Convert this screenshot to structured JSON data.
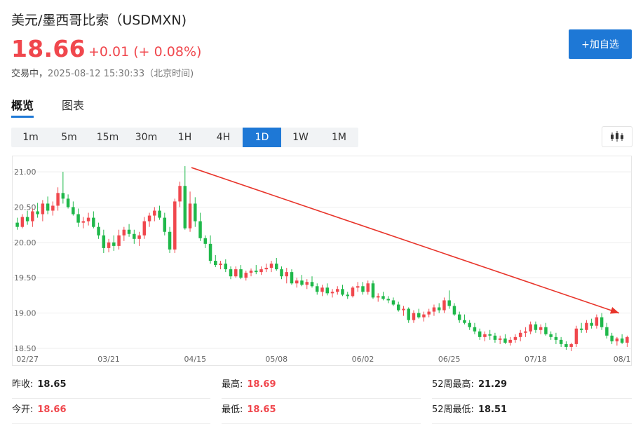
{
  "header": {
    "title": "美元/墨西哥比索（USDMXN)",
    "price": "18.66",
    "change": "+0.01 (+ 0.08%)",
    "status": "交易中，",
    "timestamp": "2025-08-12 15:30:33（北京时间)",
    "add_button": "+加自选"
  },
  "tabs": [
    {
      "label": "概览",
      "active": true
    },
    {
      "label": "图表",
      "active": false
    }
  ],
  "periods": [
    {
      "label": "1m",
      "active": false
    },
    {
      "label": "5m",
      "active": false
    },
    {
      "label": "15m",
      "active": false
    },
    {
      "label": "30m",
      "active": false
    },
    {
      "label": "1H",
      "active": false
    },
    {
      "label": "4H",
      "active": false
    },
    {
      "label": "1D",
      "active": true
    },
    {
      "label": "1W",
      "active": false
    },
    {
      "label": "1M",
      "active": false
    }
  ],
  "chart_type_icon": "candlestick-icon",
  "colors": {
    "up": "#f0474d",
    "down": "#1fb84a",
    "accent": "#1e78d6",
    "annotation_arrow": "#e8352b"
  },
  "chart_data": {
    "type": "candlestick",
    "y_ticks": [
      "21.00",
      "20.50",
      "20.00",
      "19.50",
      "19.00",
      "18.50"
    ],
    "y_tick_values": [
      21.0,
      20.5,
      20.0,
      19.5,
      19.0,
      18.5
    ],
    "ylim": [
      18.42,
      21.14
    ],
    "x_ticks": [
      "02/27",
      "03/21",
      "04/15",
      "05/08",
      "06/02",
      "06/25",
      "07/18",
      "08/1"
    ],
    "x_tick_index": [
      2,
      18,
      35,
      51,
      68,
      85,
      102,
      119
    ],
    "grid": "horizontal",
    "annotation": "downtrend arrow from the April high to the current level",
    "candles": [
      [
        20.28,
        20.35,
        20.18,
        20.22
      ],
      [
        20.22,
        20.4,
        20.2,
        20.36
      ],
      [
        20.36,
        20.45,
        20.25,
        20.3
      ],
      [
        20.3,
        20.48,
        20.22,
        20.44
      ],
      [
        20.44,
        20.56,
        20.35,
        20.4
      ],
      [
        20.4,
        20.6,
        20.3,
        20.55
      ],
      [
        20.55,
        20.65,
        20.4,
        20.45
      ],
      [
        20.45,
        20.58,
        20.38,
        20.52
      ],
      [
        20.52,
        20.78,
        20.45,
        20.7
      ],
      [
        20.7,
        21.0,
        20.55,
        20.62
      ],
      [
        20.62,
        20.68,
        20.48,
        20.5
      ],
      [
        20.5,
        20.58,
        20.38,
        20.4
      ],
      [
        20.4,
        20.48,
        20.22,
        20.28
      ],
      [
        20.28,
        20.36,
        20.2,
        20.3
      ],
      [
        20.3,
        20.42,
        20.24,
        20.35
      ],
      [
        20.35,
        20.44,
        20.2,
        20.22
      ],
      [
        20.22,
        20.28,
        20.05,
        20.1
      ],
      [
        20.1,
        20.18,
        19.85,
        19.92
      ],
      [
        19.92,
        20.05,
        19.86,
        20.0
      ],
      [
        20.0,
        20.1,
        19.88,
        19.95
      ],
      [
        19.95,
        20.18,
        19.9,
        20.1
      ],
      [
        20.1,
        20.22,
        20.02,
        20.18
      ],
      [
        20.18,
        20.26,
        20.08,
        20.12
      ],
      [
        20.12,
        20.18,
        19.98,
        20.05
      ],
      [
        20.05,
        20.15,
        19.95,
        20.1
      ],
      [
        20.1,
        20.36,
        20.05,
        20.3
      ],
      [
        20.3,
        20.42,
        20.22,
        20.38
      ],
      [
        20.38,
        20.5,
        20.3,
        20.45
      ],
      [
        20.45,
        20.52,
        20.32,
        20.35
      ],
      [
        20.35,
        20.42,
        20.1,
        20.15
      ],
      [
        20.15,
        20.22,
        19.85,
        19.9
      ],
      [
        19.9,
        20.62,
        19.85,
        20.58
      ],
      [
        20.58,
        20.86,
        20.5,
        20.8
      ],
      [
        20.8,
        21.08,
        20.18,
        20.2
      ],
      [
        20.2,
        20.72,
        20.15,
        20.55
      ],
      [
        20.55,
        20.64,
        20.22,
        20.3
      ],
      [
        20.3,
        20.42,
        20.02,
        20.06
      ],
      [
        20.06,
        20.1,
        19.92,
        19.98
      ],
      [
        19.98,
        20.1,
        19.7,
        19.74
      ],
      [
        19.74,
        19.82,
        19.65,
        19.68
      ],
      [
        19.68,
        19.74,
        19.62,
        19.7
      ],
      [
        19.7,
        19.76,
        19.58,
        19.62
      ],
      [
        19.62,
        19.66,
        19.48,
        19.52
      ],
      [
        19.52,
        19.66,
        19.5,
        19.62
      ],
      [
        19.62,
        19.68,
        19.48,
        19.5
      ],
      [
        19.5,
        19.6,
        19.46,
        19.57
      ],
      [
        19.57,
        19.63,
        19.52,
        19.6
      ],
      [
        19.6,
        19.68,
        19.55,
        19.58
      ],
      [
        19.58,
        19.66,
        19.54,
        19.62
      ],
      [
        19.62,
        19.7,
        19.58,
        19.64
      ],
      [
        19.64,
        19.74,
        19.58,
        19.7
      ],
      [
        19.7,
        19.78,
        19.6,
        19.62
      ],
      [
        19.62,
        19.66,
        19.48,
        19.52
      ],
      [
        19.52,
        19.64,
        19.42,
        19.58
      ],
      [
        19.58,
        19.62,
        19.4,
        19.42
      ],
      [
        19.42,
        19.5,
        19.36,
        19.46
      ],
      [
        19.46,
        19.54,
        19.38,
        19.4
      ],
      [
        19.4,
        19.48,
        19.34,
        19.44
      ],
      [
        19.44,
        19.52,
        19.36,
        19.38
      ],
      [
        19.38,
        19.42,
        19.26,
        19.3
      ],
      [
        19.3,
        19.4,
        19.24,
        19.36
      ],
      [
        19.36,
        19.42,
        19.25,
        19.28
      ],
      [
        19.28,
        19.34,
        19.22,
        19.3
      ],
      [
        19.3,
        19.38,
        19.26,
        19.34
      ],
      [
        19.34,
        19.4,
        19.24,
        19.26
      ],
      [
        19.26,
        19.3,
        19.2,
        19.24
      ],
      [
        19.24,
        19.38,
        19.22,
        19.36
      ],
      [
        19.36,
        19.44,
        19.3,
        19.38
      ],
      [
        19.38,
        19.44,
        19.26,
        19.3
      ],
      [
        19.3,
        19.46,
        19.26,
        19.42
      ],
      [
        19.42,
        19.46,
        19.2,
        19.22
      ],
      [
        19.22,
        19.28,
        19.16,
        19.24
      ],
      [
        19.24,
        19.3,
        19.18,
        19.2
      ],
      [
        19.2,
        19.24,
        19.14,
        19.18
      ],
      [
        19.18,
        19.22,
        19.1,
        19.12
      ],
      [
        19.12,
        19.16,
        19.02,
        19.04
      ],
      [
        19.04,
        19.1,
        18.96,
        19.06
      ],
      [
        19.06,
        19.08,
        18.86,
        18.9
      ],
      [
        18.9,
        19.04,
        18.86,
        19.0
      ],
      [
        19.0,
        19.06,
        18.92,
        18.94
      ],
      [
        18.94,
        19.02,
        18.88,
        18.98
      ],
      [
        18.98,
        19.06,
        18.94,
        19.02
      ],
      [
        19.02,
        19.12,
        18.96,
        19.08
      ],
      [
        19.08,
        19.14,
        19.0,
        19.04
      ],
      [
        19.04,
        19.22,
        19.0,
        19.18
      ],
      [
        19.18,
        19.32,
        19.06,
        19.1
      ],
      [
        19.1,
        19.14,
        18.96,
        18.98
      ],
      [
        18.98,
        19.02,
        18.86,
        18.9
      ],
      [
        18.9,
        18.98,
        18.84,
        18.86
      ],
      [
        18.86,
        18.9,
        18.76,
        18.8
      ],
      [
        18.8,
        18.86,
        18.7,
        18.74
      ],
      [
        18.74,
        18.78,
        18.62,
        18.66
      ],
      [
        18.66,
        18.74,
        18.6,
        18.7
      ],
      [
        18.7,
        18.76,
        18.62,
        18.68
      ],
      [
        18.68,
        18.72,
        18.58,
        18.62
      ],
      [
        18.62,
        18.68,
        18.56,
        18.64
      ],
      [
        18.64,
        18.7,
        18.56,
        18.58
      ],
      [
        18.58,
        18.66,
        18.54,
        18.62
      ],
      [
        18.62,
        18.7,
        18.58,
        18.66
      ],
      [
        18.66,
        18.76,
        18.6,
        18.72
      ],
      [
        18.72,
        18.8,
        18.66,
        18.74
      ],
      [
        18.74,
        18.88,
        18.7,
        18.84
      ],
      [
        18.84,
        18.88,
        18.72,
        18.76
      ],
      [
        18.76,
        18.84,
        18.7,
        18.8
      ],
      [
        18.8,
        18.86,
        18.68,
        18.7
      ],
      [
        18.7,
        18.74,
        18.62,
        18.66
      ],
      [
        18.66,
        18.72,
        18.56,
        18.62
      ],
      [
        18.62,
        18.66,
        18.52,
        18.56
      ],
      [
        18.56,
        18.6,
        18.48,
        18.52
      ],
      [
        18.52,
        18.58,
        18.46,
        18.56
      ],
      [
        18.56,
        18.82,
        18.52,
        18.78
      ],
      [
        18.78,
        18.86,
        18.72,
        18.76
      ],
      [
        18.76,
        18.9,
        18.72,
        18.86
      ],
      [
        18.86,
        18.92,
        18.78,
        18.82
      ],
      [
        18.82,
        18.98,
        18.78,
        18.94
      ],
      [
        18.94,
        19.0,
        18.76,
        18.8
      ],
      [
        18.8,
        18.86,
        18.64,
        18.68
      ],
      [
        18.68,
        18.72,
        18.56,
        18.6
      ],
      [
        18.6,
        18.66,
        18.54,
        18.64
      ],
      [
        18.64,
        18.7,
        18.56,
        18.58
      ],
      [
        18.58,
        18.68,
        18.52,
        18.66
      ]
    ]
  },
  "stats": [
    {
      "label": "昨收:",
      "value": "18.65",
      "color": "dark"
    },
    {
      "label": "最高:",
      "value": "18.69",
      "color": "red"
    },
    {
      "label": "52周最高:",
      "value": "21.29",
      "color": "dark"
    },
    {
      "label": "今开:",
      "value": "18.66",
      "color": "red"
    },
    {
      "label": "最低:",
      "value": "18.65",
      "color": "red"
    },
    {
      "label": "52周最低:",
      "value": "18.51",
      "color": "dark"
    }
  ]
}
